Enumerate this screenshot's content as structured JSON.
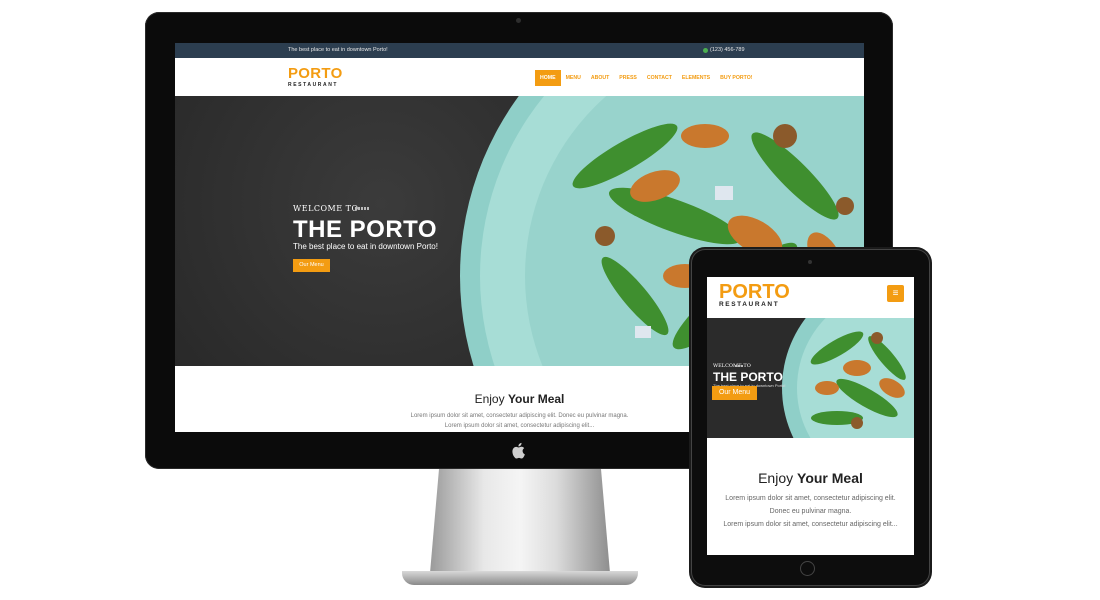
{
  "desktop": {
    "topbar": {
      "tagline": "The best place to eat in downtown Porto!",
      "phone": "(123) 456-789"
    },
    "brand": {
      "name": "PORTO",
      "sub": "RESTAURANT"
    },
    "nav": {
      "items": [
        {
          "label": "HOME",
          "active": true
        },
        {
          "label": "MENU",
          "active": false
        },
        {
          "label": "ABOUT",
          "active": false
        },
        {
          "label": "PRESS",
          "active": false
        },
        {
          "label": "CONTACT",
          "active": false
        },
        {
          "label": "ELEMENTS",
          "active": false
        },
        {
          "label": "BUY PORTO!",
          "active": false
        }
      ]
    },
    "hero": {
      "welcome": "WELCOME TO",
      "title": "THE PORTO",
      "subtitle": "The best place to eat in downtown Porto!",
      "button": "Our Menu"
    },
    "section": {
      "title_light": "Enjoy ",
      "title_bold": "Your Meal",
      "line1": "Lorem ipsum dolor sit amet, consectetur adipiscing elit. Donec eu pulvinar magna.",
      "line2": "Lorem ipsum dolor sit amet, consectetur adipiscing elit..."
    }
  },
  "tablet": {
    "brand": {
      "name": "PORTO",
      "sub": "RESTAURANT"
    },
    "menu_icon": "hamburger-icon",
    "hero": {
      "welcome": "WELCOME TO",
      "title": "THE PORTO",
      "subtitle": "The best place to eat in downtown Porto!",
      "button": "Our Menu"
    },
    "section": {
      "title_light": "Enjoy ",
      "title_bold": "Your Meal",
      "line1": "Lorem ipsum dolor sit amet, consectetur adipiscing elit.",
      "line2": "Donec eu pulvinar magna.",
      "line3": "Lorem ipsum dolor sit amet, consectetur adipiscing elit..."
    }
  },
  "colors": {
    "accent": "#f39c12",
    "topbar": "#2c3e50",
    "plate": "#9fd8d2",
    "arugula": "#3f8f2f"
  }
}
